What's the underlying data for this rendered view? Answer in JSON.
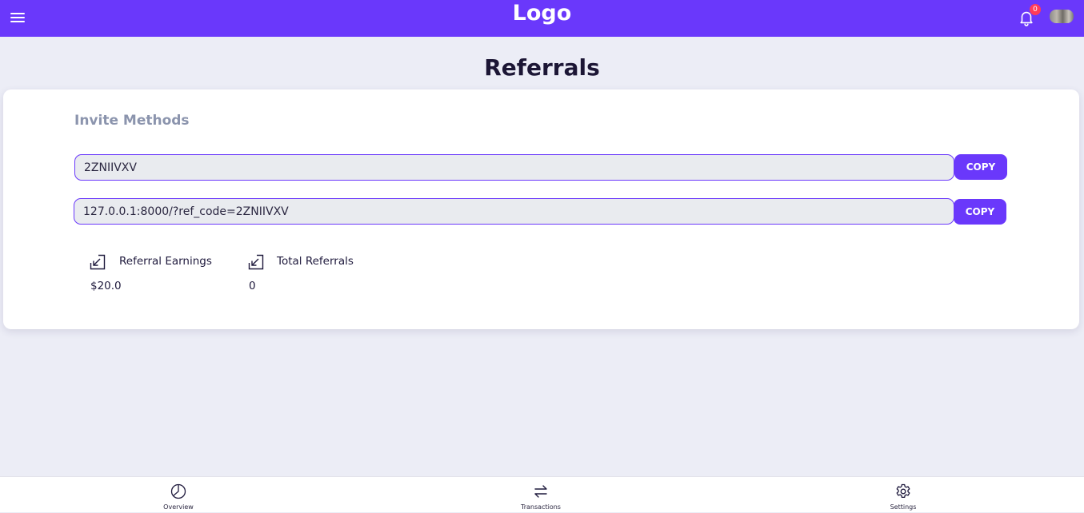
{
  "header": {
    "logo_text": "Logo",
    "notification_count": "0",
    "menu_icon": "hamburger-menu-icon",
    "bell_icon": "bell-icon",
    "brand_color": "#6a38fb",
    "badge_color": "#ff3b58"
  },
  "page": {
    "title": "Referrals"
  },
  "invite": {
    "section_title": "Invite Methods",
    "ref_code": "2ZNIIVXV",
    "ref_link": "127.0.0.1:8000/?ref_code=2ZNIIVXV",
    "copy_label": "COPY"
  },
  "stats": [
    {
      "label": "Referral Earnings",
      "value": "$20.0",
      "icon": "arrow-down-left-box-icon"
    },
    {
      "label": "Total Referrals",
      "value": "0",
      "icon": "arrow-down-left-box-icon"
    }
  ],
  "bottom_nav": [
    {
      "label": "Overview",
      "icon": "pie-chart-icon"
    },
    {
      "label": "Transactions",
      "icon": "swap-arrows-icon"
    },
    {
      "label": "Settings",
      "icon": "gear-icon"
    }
  ]
}
